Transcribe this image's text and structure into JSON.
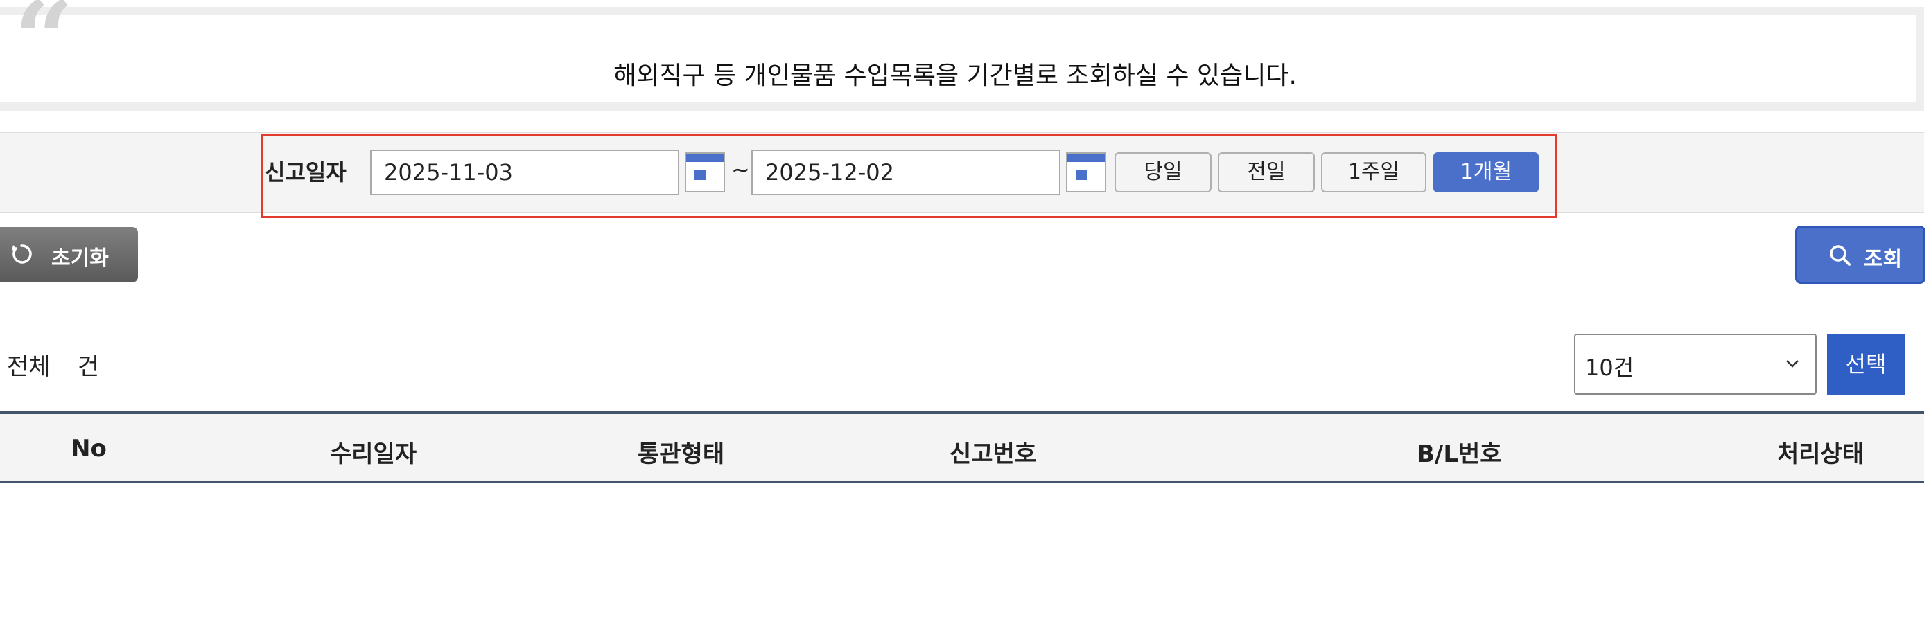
{
  "notice": {
    "text": "해외직구 등 개인물품 수입목록을 기간별로 조회하실 수 있습니다."
  },
  "search": {
    "date_label": "신고일자",
    "start_date": "2025-11-03",
    "separator": "~",
    "end_date": "2025-12-02",
    "period_buttons": [
      "당일",
      "전일",
      "1주일",
      "1개월"
    ],
    "active_period": "1개월"
  },
  "actions": {
    "reset_label": "초기화",
    "query_label": "조회"
  },
  "results": {
    "total_label": "전체",
    "total_count": "",
    "total_unit": "건",
    "page_size_selected": "10건",
    "select_label": "선택"
  },
  "table": {
    "columns": [
      "No",
      "수리일자",
      "통관형태",
      "신고번호",
      "B/L번호",
      "처리상태"
    ]
  },
  "colors": {
    "accent": "#4a70c9",
    "select_button": "#2f5fc4",
    "highlight_border": "#e53b2c",
    "table_rule": "#44546a"
  }
}
